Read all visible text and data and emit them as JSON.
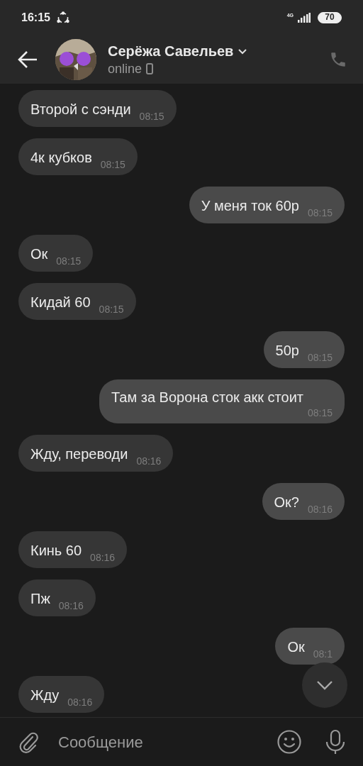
{
  "status_bar": {
    "time": "16:15",
    "network": "4G",
    "battery": "70"
  },
  "header": {
    "name": "Серёжа Савельев",
    "status": "online"
  },
  "messages": [
    {
      "text": "Второй с сэнди",
      "time": "08:15",
      "outgoing": false
    },
    {
      "text": "4к кубков",
      "time": "08:15",
      "outgoing": false
    },
    {
      "text": "У меня ток 60р",
      "time": "08:15",
      "outgoing": true
    },
    {
      "text": "Ок",
      "time": "08:15",
      "outgoing": false
    },
    {
      "text": "Кидай 60",
      "time": "08:15",
      "outgoing": false
    },
    {
      "text": "50р",
      "time": "08:15",
      "outgoing": true
    },
    {
      "text": "Там за Ворона сток акк стоит",
      "time": "08:15",
      "outgoing": true
    },
    {
      "text": "Жду, переводи",
      "time": "08:16",
      "outgoing": false
    },
    {
      "text": "Ок?",
      "time": "08:16",
      "outgoing": true
    },
    {
      "text": "Кинь 60",
      "time": "08:16",
      "outgoing": false
    },
    {
      "text": "Пж",
      "time": "08:16",
      "outgoing": false
    },
    {
      "text": "Ок",
      "time": "08:1",
      "outgoing": true
    },
    {
      "text": "Жду",
      "time": "08:16",
      "outgoing": false
    }
  ],
  "composer": {
    "placeholder": "Сообщение"
  }
}
